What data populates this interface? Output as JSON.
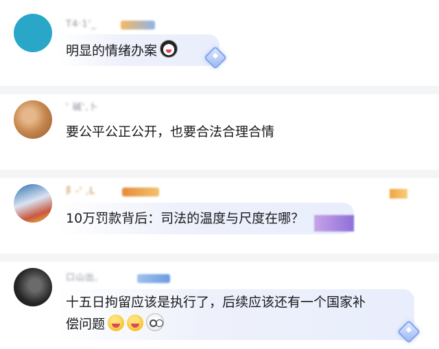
{
  "comments": [
    {
      "username": "T4·1'_",
      "text": "明显的情绪办案",
      "emoji": "panda-emoji",
      "avatar_color": "#2aa6c9",
      "has_reply_icon": true
    },
    {
      "username": "' 碱',卜",
      "text": "要公平公正公开，也要合法合理合情",
      "avatar_color": "#c7874f",
      "has_reply_icon": false
    },
    {
      "username": "阝-' ‚L",
      "text": "10万罚款背后：司法的温度与尺度在哪？",
      "avatar_color": "#3f6fa8",
      "has_reply_icon": false
    },
    {
      "username": "口山出,",
      "text_line1": "十五日拘留应该是执行了，后续应该还有一个国家补",
      "text_line2": "偿问题",
      "emojis": [
        "grin-emoji",
        "grin-emoji",
        "dizzy-emoji"
      ],
      "avatar_color": "#262626",
      "has_reply_icon": true
    }
  ],
  "colors": {
    "text": "#18191c",
    "username": "#8a8f99",
    "divider": "#f4f5f7",
    "bubble": "#e9eefc",
    "accent": "#7fa2ea"
  }
}
